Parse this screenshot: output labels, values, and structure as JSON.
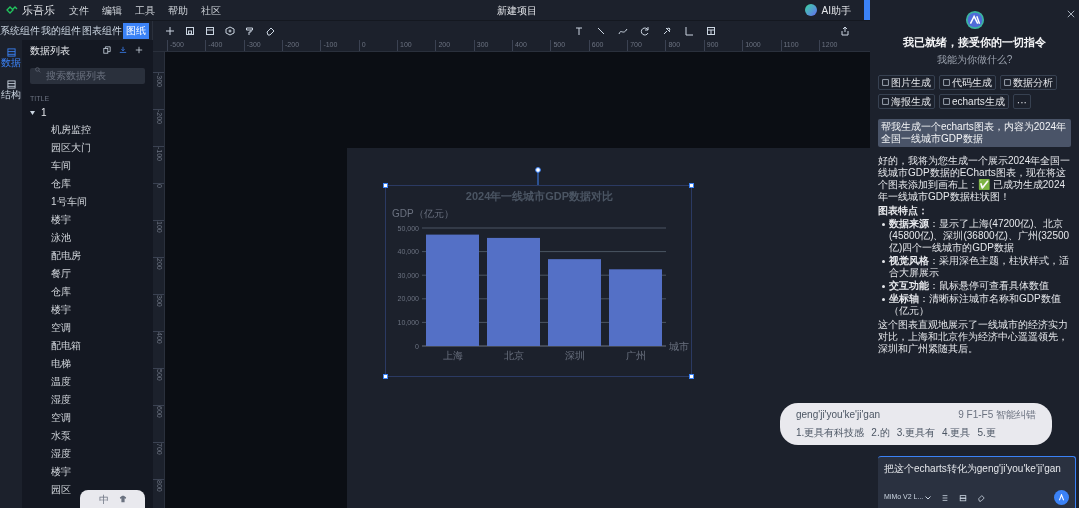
{
  "app": {
    "logo_text": "乐吾乐",
    "menu": [
      "文件",
      "编辑",
      "工具",
      "帮助",
      "社区"
    ],
    "project_title": "新建项目",
    "ai_button": "AI助手"
  },
  "component_tabs": [
    {
      "label": "系统组件",
      "selected": false
    },
    {
      "label": "我的组件",
      "selected": false
    },
    {
      "label": "图表组件",
      "selected": false
    },
    {
      "label": "图纸",
      "selected": true
    }
  ],
  "rail": [
    {
      "label": "数据",
      "selected": true
    },
    {
      "label": "结构",
      "selected": false
    }
  ],
  "data_panel": {
    "title": "数据列表",
    "search": {
      "placeholder": "搜索数据列表"
    },
    "section": "TITLE",
    "tree": [
      {
        "label": "1",
        "expanded": true,
        "children": [
          {
            "label": "机房监控"
          },
          {
            "label": "园区大门"
          },
          {
            "label": "车间"
          },
          {
            "label": "仓库"
          },
          {
            "label": "1号车间"
          },
          {
            "label": "楼宇"
          },
          {
            "label": "泳池"
          },
          {
            "label": "配电房"
          },
          {
            "label": "餐厅"
          },
          {
            "label": "仓库"
          },
          {
            "label": "楼宇"
          },
          {
            "label": "空调"
          },
          {
            "label": "配电箱"
          },
          {
            "label": "电梯"
          },
          {
            "label": "温度"
          },
          {
            "label": "湿度"
          },
          {
            "label": "空调"
          },
          {
            "label": "水泵"
          },
          {
            "label": "湿度"
          },
          {
            "label": "楼宇"
          },
          {
            "label": "园区"
          }
        ]
      }
    ]
  },
  "ruler_h": [
    "-500",
    "-400",
    "-300",
    "-200",
    "-100",
    "0",
    "100",
    "200",
    "300",
    "400",
    "500",
    "600",
    "700",
    "800",
    "900",
    "1000",
    "1100",
    "1200"
  ],
  "ruler_v": [
    "-300",
    "-200",
    "-100",
    "0",
    "100",
    "200",
    "300",
    "400",
    "500",
    "600",
    "700",
    "800"
  ],
  "canvas_chart": {
    "chart_data": {
      "type": "bar",
      "title": "2024年一线城市GDP数据对比",
      "xlabel": "城市",
      "ylabel": "GDP（亿元）",
      "categories": [
        "上海",
        "北京",
        "深圳",
        "广州"
      ],
      "grid": true,
      "series": [
        {
          "color": "#5470c6",
          "values": [
            47200,
            45800,
            36800,
            32500
          ]
        }
      ],
      "ylim": [
        0,
        50000
      ],
      "yticks": [
        {
          "value": 0,
          "label": "0"
        },
        {
          "value": 10000,
          "label": "10,000"
        },
        {
          "value": 20000,
          "label": "20,000"
        },
        {
          "value": 30000,
          "label": "30,000"
        },
        {
          "value": 40000,
          "label": "40,000"
        },
        {
          "value": 50000,
          "label": "50,000"
        }
      ]
    }
  },
  "assistant": {
    "greeting": "我已就绪，接受你的一切指令",
    "subtitle": "我能为你做什么?",
    "chips": [
      "图片生成",
      "代码生成",
      "数据分析",
      "海报生成",
      "echarts生成"
    ],
    "more": "···",
    "user_message": "帮我生成一个echarts图表，内容为2024年全国一线城市GDP数据",
    "reply_intro": "好的，我将为您生成一个展示2024年全国一线城市GDP数据的ECharts图表，现在将这个图表添加到画布上：✅ 已成功生成2024年一线城市GDP数据柱状图！",
    "reply_heading": "图表特点：",
    "reply_points": [
      "**数据来源**：显示了上海(47200亿)、北京(45800亿)、深圳(36800亿)、广州(32500亿)四个一线城市的GDP数据",
      "**视觉风格**：采用深色主题，柱状样式，适合大屏展示",
      "**交互功能**：鼠标悬停可查看具体数值",
      "**坐标轴**：清晰标注城市名称和GDP数值（亿元）"
    ],
    "reply_outro": "这个图表直观地展示了一线城市的经济实力对比，上海和北京作为经济中心遥遥领先，深圳和广州紧随其后。",
    "input_value": "把这个echarts转化为geng'ji'you'ke'ji'gan",
    "model": "MiMo V2 L..."
  },
  "ime": {
    "composition": "geng'ji'you'ke'ji'gan",
    "hint": "9 F1-F5 智能纠错",
    "candidates": [
      "1.更具有科技感",
      "2.的",
      "3.更具有",
      "4.更具",
      "5.更"
    ],
    "mode": "中"
  }
}
